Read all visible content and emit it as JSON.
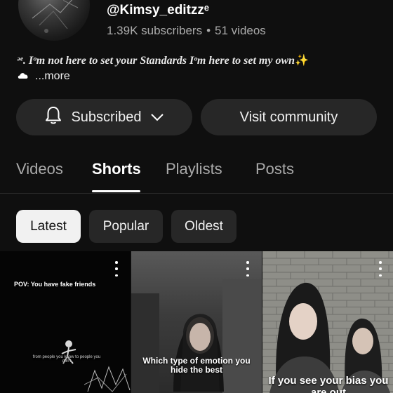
{
  "channel": {
    "handle": "@Kimsy_editzzᵉ",
    "subscribers": "1.39K subscribers",
    "separator": "•",
    "videos": "51 videos",
    "bio_prefix": "ᵊᵉ.",
    "bio_text": "Iᵒm not here to set your Standards Iᵒm here to set my own",
    "bio_emoji": "✨",
    "more_label": "...more"
  },
  "actions": {
    "subscribed_label": "Subscribed",
    "visit_label": "Visit community"
  },
  "tabs": [
    {
      "label": "Videos",
      "active": false
    },
    {
      "label": "Shorts",
      "active": true
    },
    {
      "label": "Playlists",
      "active": false
    },
    {
      "label": "Posts",
      "active": false
    }
  ],
  "chips": [
    {
      "label": "Latest",
      "active": true
    },
    {
      "label": "Popular",
      "active": false
    },
    {
      "label": "Oldest",
      "active": false
    }
  ],
  "shorts": [
    {
      "title_overlay": "POV: You have fake friends",
      "sub_overlay": "from people you know to people you don't",
      "icon": "more-vert-icon"
    },
    {
      "title_overlay": "Which type of emotion you hide the best",
      "icon": "more-vert-icon"
    },
    {
      "title_overlay": "If you see your bias you are out",
      "icon": "more-vert-icon"
    }
  ],
  "colors": {
    "background": "#0f0f0f",
    "button_bg": "#272727",
    "secondary_text": "#aaaaaa",
    "chip_active_bg": "#f1f1f1"
  }
}
